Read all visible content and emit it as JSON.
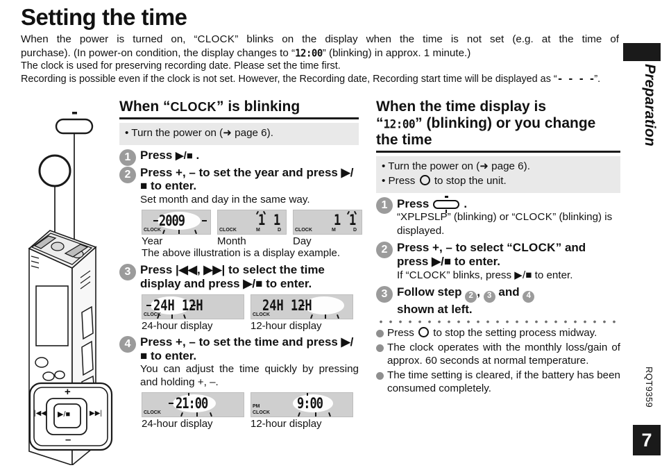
{
  "page": {
    "title": "Setting the time",
    "intro_line1": "When the power is turned on, “CLOCK” blinks on the display when the time is not set (e.g. at the time of",
    "intro_line1a": "When the power is turned on, “",
    "intro_clock1": "CLOCK",
    "intro_line1b": "” blinks on the display when the time is not set (e.g. at the time of",
    "intro_line2a": "purchase). (In power-on condition, the display changes to “",
    "intro_seg_1200": "12:00",
    "intro_line2b": "” (blinking) in approx. 1 minute.)",
    "intro_line3": "The clock is used for preserving recording date. Please set the time first.",
    "intro_line4a": "Recording is possible even if the clock is not set. However, the Recording date, Recording start time will be displayed as “",
    "intro_dashes": "- - - -",
    "intro_line4b": "”."
  },
  "sidebar": {
    "section_label": "Preparation",
    "doc_code": "RQT9359",
    "page_number": "7"
  },
  "left_column": {
    "heading_a": "When “",
    "heading_clock": "CLOCK",
    "heading_b": "” is blinking",
    "note_box": "• Turn the power on (➜ page 6).",
    "steps": [
      {
        "num": "1",
        "title_a": "Press ",
        "title_glyph": "▶/■",
        "title_b": " ."
      },
      {
        "num": "2",
        "title": "Press +, – to set the year and press ▶/■ to enter.",
        "sub": "Set month and day in the same way."
      },
      {
        "num": "3",
        "title": "Press |◀◀, ▶▶| to select the time display and press ▶/■ to enter."
      },
      {
        "num": "4",
        "title": "Press +, – to set the time and press ▶/■ to enter.",
        "sub": "You can adjust the time quickly by pressing and holding +, –."
      }
    ],
    "date_figures": {
      "captions": [
        "Year",
        "Month",
        "Day"
      ],
      "year_value": "2009",
      "month_value": "1",
      "day_value": "1",
      "clock_label": "CLOCK",
      "m_label": "M",
      "d_label": "D",
      "note": "The above illustration is a display example."
    },
    "format_figures": {
      "left_value": "24H 12H",
      "right_value": "24H 12H",
      "left_caption": "24-hour display",
      "right_caption": "12-hour display",
      "clock_label": "CLOCK"
    },
    "time_figures": {
      "left_value": "21:00",
      "right_value": "9:00",
      "left_caption": "24-hour display",
      "right_caption": "12-hour display",
      "clock_label": "CLOCK",
      "pm_label": "PM"
    }
  },
  "right_column": {
    "heading_line1": "When the time display is",
    "heading_seg": "12:00",
    "heading_line2b": "” (blinking) or you change",
    "heading_line3": "the time",
    "heading_quote_open": "“",
    "note_box": [
      "• Turn the power on (➜ page 6).",
      "• Press ◯ to stop the unit."
    ],
    "note_box_1": "Turn the power on (➜ page 6).",
    "note_box_2a": "Press ",
    "note_box_2b": " to stop the unit.",
    "steps": [
      {
        "num": "1",
        "title": "Press",
        "title_tail": ".",
        "sub_a": "“XPLPSLP” (blinking) or “",
        "sub_clock": "CLOCK",
        "sub_b": "” (blinking) is displayed."
      },
      {
        "num": "2",
        "title_a": "Press +, – to select “",
        "title_clock": "CLOCK",
        "title_b": "” and press ▶/■ to enter.",
        "sub_a": "If “",
        "sub_clock": "CLOCK",
        "sub_b": "” blinks, press ▶/■ to enter."
      },
      {
        "num": "3",
        "title_a": "Follow step ",
        "ref1": "2",
        "ref_sep": ", ",
        "ref2": "3",
        "ref_and": " and ",
        "ref3": "4",
        "title_b": "shown at left."
      }
    ],
    "notes": [
      {
        "a": "Press ",
        "b": " to stop the setting process midway."
      },
      {
        "text": "The clock operates with the monthly loss/gain of approx. 60 seconds at normal temperature."
      },
      {
        "text": "The time setting is cleared, if the battery has been consumed completely."
      }
    ],
    "note_2": "The clock operates with the monthly loss/gain of approx. 60 seconds at normal temperature.",
    "note_3": "The time setting is cleared, if the battery has been consumed completely."
  },
  "device_illustration": {
    "plus_label": "+",
    "minus_label": "–",
    "rew_label": "|◀◀",
    "ff_label": "▶▶|",
    "play_label": "▶/■"
  },
  "colors": {
    "accent_grey": "#9b9b9b",
    "note_band": "#e9e9e9",
    "lcd_bg": "#cfcfcf",
    "black": "#1a1a1a"
  }
}
